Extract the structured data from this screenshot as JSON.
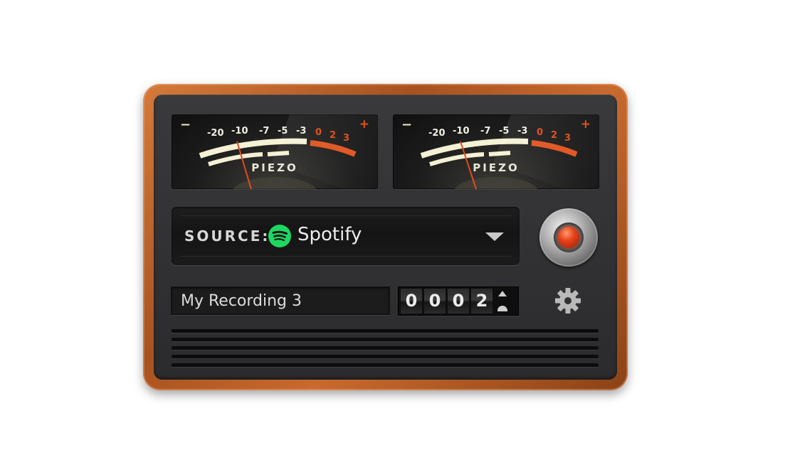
{
  "meters": [
    {
      "scale_marks": [
        "-20",
        "-10",
        "-7",
        "-5",
        "-3"
      ],
      "red_marks": [
        "0",
        "2",
        "3"
      ],
      "brand": "PIEZO",
      "minus": "−",
      "plus": "+"
    },
    {
      "scale_marks": [
        "-20",
        "-10",
        "-7",
        "-5",
        "-3"
      ],
      "red_marks": [
        "0",
        "2",
        "3"
      ],
      "brand": "PIEZO",
      "minus": "−",
      "plus": "+"
    }
  ],
  "source": {
    "label": "SOURCE:",
    "value": "Spotify",
    "icon": "spotify-icon",
    "dropdown_icon": "chevron-down-icon"
  },
  "record_button": {
    "icon": "record-light-icon",
    "light_color": "#e5411a"
  },
  "recording_name": "My Recording 3",
  "timer": {
    "digits": [
      "0",
      "0",
      "0",
      "2"
    ]
  },
  "settings": {
    "icon": "gear-icon"
  },
  "colors": {
    "wood": "#b5602a",
    "panel": "#323234",
    "accent_red": "#e0521e",
    "spotify_green": "#1ed760"
  }
}
